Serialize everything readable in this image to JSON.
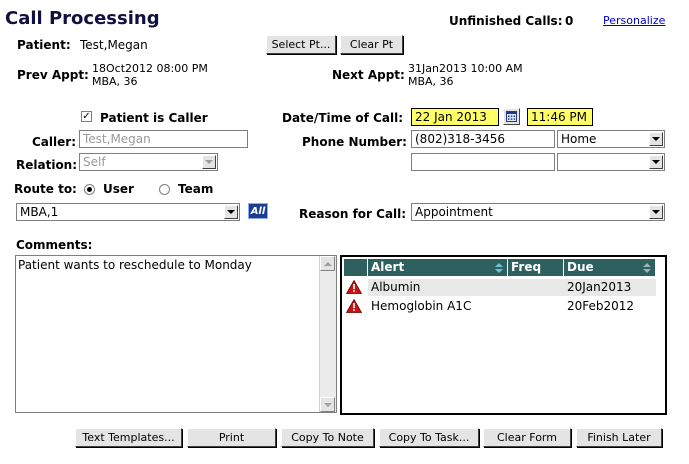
{
  "header": {
    "title": "Call Processing",
    "unfinished_label": "Unfinished Calls:",
    "unfinished_count": "0",
    "personalize_link": "Personalize"
  },
  "patient": {
    "label": "Patient:",
    "name": "Test,Megan",
    "select_btn": "Select Pt...",
    "clear_btn": "Clear Pt"
  },
  "appointments": {
    "prev_label": "Prev Appt:",
    "prev_datetime": "18Oct2012 08:00 PM",
    "prev_location": "MBA, 36",
    "next_label": "Next Appt:",
    "next_datetime": "31Jan2013 10:00 AM",
    "next_location": "MBA, 36"
  },
  "caller": {
    "is_caller_label": "Patient is Caller",
    "is_caller_checked": true,
    "caller_label": "Caller:",
    "caller_value": "Test,Megan",
    "relation_label": "Relation:",
    "relation_value": "Self"
  },
  "call_time": {
    "label": "Date/Time of Call:",
    "date": "22 Jan 2013",
    "time": "11:46 PM"
  },
  "phone": {
    "label": "Phone Number:",
    "number1": "(802)318-3456",
    "type1": "Home",
    "number2": "",
    "type2": ""
  },
  "route": {
    "label": "Route to:",
    "option_user": "User",
    "option_team": "Team",
    "selected": "User",
    "value": "MBA,1",
    "all_btn": "All"
  },
  "reason": {
    "label": "Reason for Call:",
    "value": "Appointment"
  },
  "comments": {
    "label": "Comments:",
    "text": "Patient wants to reschedule to Monday"
  },
  "alerts": {
    "columns": [
      "Alert",
      "Freq",
      "Due"
    ],
    "rows": [
      {
        "alert": "Albumin",
        "freq": "",
        "due": "20Jan2013"
      },
      {
        "alert": "Hemoglobin A1C",
        "freq": "",
        "due": "20Feb2012"
      }
    ]
  },
  "footer_buttons": {
    "text_templates": "Text Templates...",
    "print": "Print",
    "copy_to_note": "Copy To Note",
    "copy_to_task": "Copy To Task...",
    "clear_form": "Clear Form",
    "finish_later": "Finish Later"
  }
}
